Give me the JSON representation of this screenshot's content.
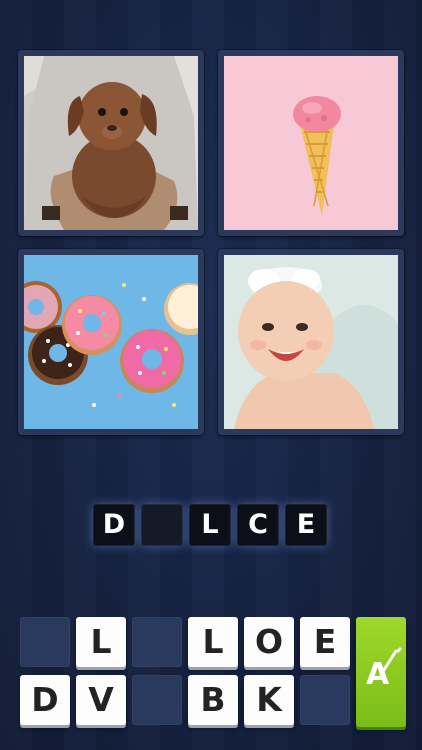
{
  "pictures": [
    {
      "icon": "dog-puppy-photo"
    },
    {
      "icon": "ice-cream-cone-photo"
    },
    {
      "icon": "donuts-photo"
    },
    {
      "icon": "baby-photo"
    }
  ],
  "answer": {
    "slots": [
      "D",
      "",
      "L",
      "C",
      "E"
    ]
  },
  "keyboard": {
    "row1": [
      "",
      "L",
      "",
      "L",
      "O",
      "E"
    ],
    "row2": [
      "D",
      "V",
      "",
      "B",
      "K",
      ""
    ],
    "hint_label": "A",
    "hint_color": "#8ccc22"
  },
  "colors": {
    "background": "#172447",
    "slot": "#0c0f18",
    "key": "#fdfdfd"
  }
}
